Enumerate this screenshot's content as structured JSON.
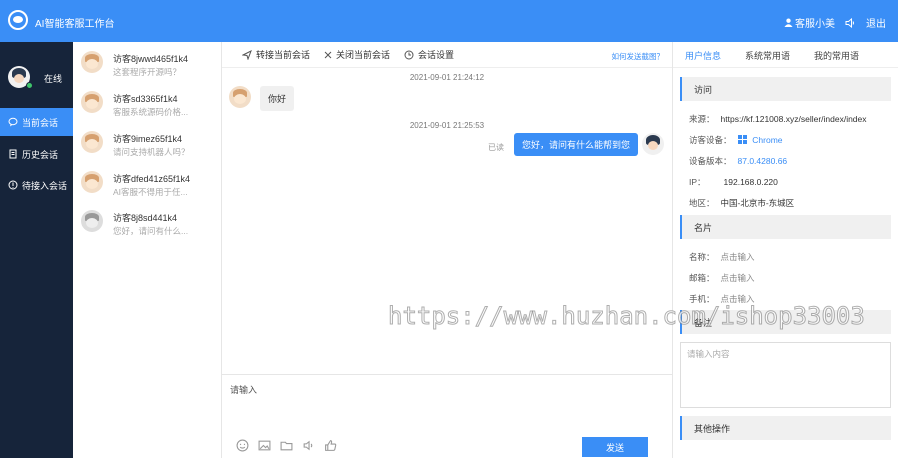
{
  "app": {
    "title": "AI智能客服工作台"
  },
  "topbar": {
    "user": "客服小美",
    "logout": "退出"
  },
  "sidebar": {
    "status": "在线",
    "nav": [
      {
        "label": "当前会话",
        "icon": "chat-icon",
        "active": true
      },
      {
        "label": "历史会话",
        "icon": "document-icon",
        "active": false
      },
      {
        "label": "待接入会话",
        "icon": "info-icon",
        "active": false
      }
    ]
  },
  "visitors": [
    {
      "name": "访客8jwwd465f1k4",
      "preview": "这套程序开源吗？"
    },
    {
      "name": "访客sd3365f1k4",
      "preview": "客服系统源码价格..."
    },
    {
      "name": "访客9imez65f1k4",
      "preview": "请问支持机器人吗？"
    },
    {
      "name": "访客dfed41z65f1k4",
      "preview": "AI客服不得用于任..."
    },
    {
      "name": "访客8j8sd441k4",
      "preview": "您好，请问有什么..."
    }
  ],
  "chat": {
    "toolbar": {
      "transfer": "转接当前会话",
      "close": "关闭当前会话",
      "settings": "会话设置",
      "help": "如何发送截图？"
    },
    "messages": [
      {
        "time": "2021-09-01 21:24:12",
        "from": "visitor",
        "text": "你好"
      },
      {
        "time": "2021-09-01 21:25:53",
        "from": "agent",
        "text": "您好，请问有什么能帮到您",
        "status": "已读"
      }
    ],
    "input_placeholder": "请输入",
    "send": "发送"
  },
  "panel": {
    "tabs": [
      "用户信息",
      "系统常用语",
      "我的常用语"
    ],
    "visit": {
      "title": "访问",
      "source_label": "来源：",
      "source": "https://kf.121008.xyz/seller/index/index",
      "device_label": "访客设备：",
      "device": "Chrome",
      "version_label": "设备版本：",
      "version": "87.0.4280.66",
      "ip_label": "IP：",
      "ip": "192.168.0.220",
      "region_label": "地区：",
      "region": "中国-北京市-东城区"
    },
    "card": {
      "title": "名片",
      "name_label": "名称：",
      "email_label": "邮箱：",
      "phone_label": "手机：",
      "placeholder": "点击输入"
    },
    "note": {
      "title": "备注",
      "placeholder": "请输入内容"
    },
    "other": {
      "title": "其他操作"
    }
  },
  "watermark": "https://www.huzhan.com/ishop33003",
  "colors": {
    "accent": "#3a8ef6",
    "sidebar": "#16243a",
    "online": "#3fc56b"
  }
}
